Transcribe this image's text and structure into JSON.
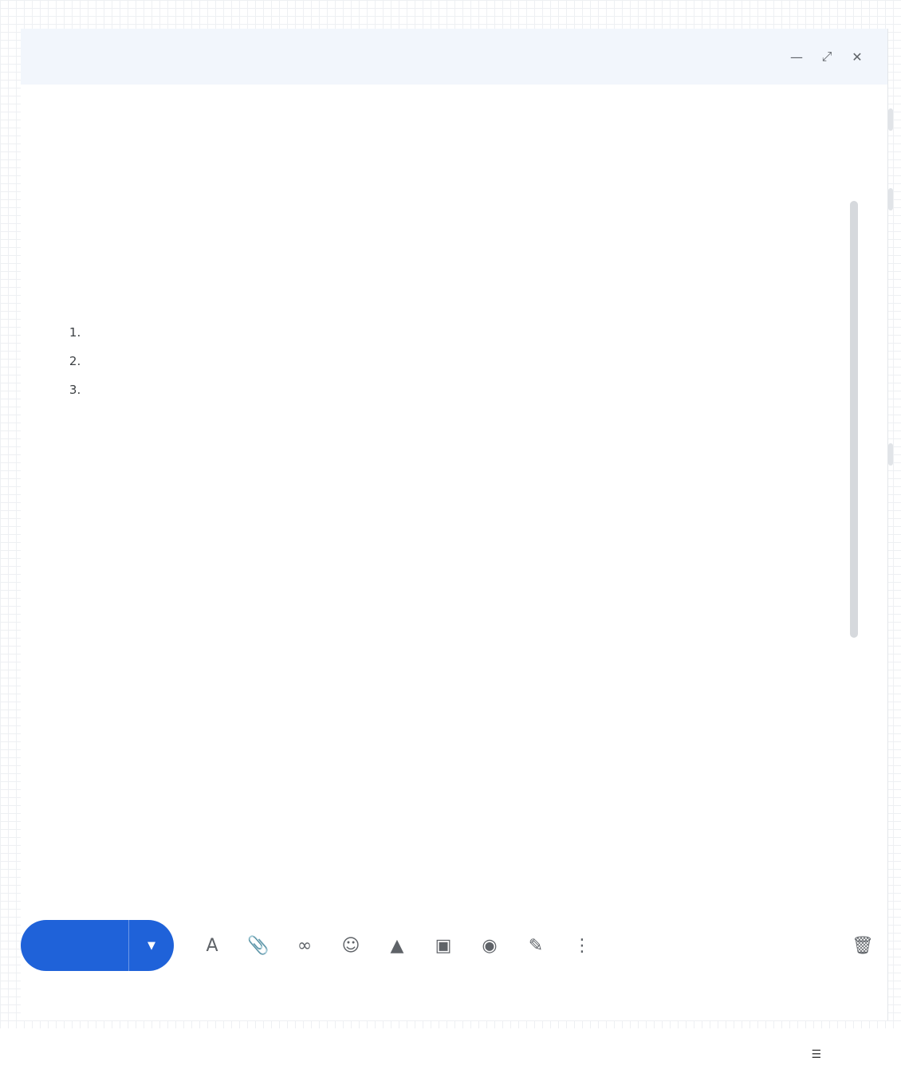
{
  "header": {
    "title": "",
    "minimize_icon": "minimize-icon",
    "expand_icon": "expand-icon",
    "close_icon": "close-icon"
  },
  "to": {
    "recipient": "",
    "cc_bcc": ""
  },
  "subject": "",
  "body": {
    "paragraphs": [
      "",
      "",
      "",
      "",
      "",
      "",
      ""
    ],
    "intro_to_list": "",
    "list": [
      "",
      "",
      ""
    ]
  },
  "toolbar": {
    "send_label": "",
    "icons": [
      "format-text-icon",
      "attach-icon",
      "link-icon",
      "emoji-icon",
      "drive-icon",
      "photo-icon",
      "lock-icon",
      "signature-icon",
      "more-options-icon",
      "delete-icon"
    ]
  },
  "footer": {
    "logo_top": "",
    "logo_bottom": "",
    "nav": [
      "",
      "",
      "",
      "",
      "",
      ""
    ],
    "menu_icon": "menu-icon"
  },
  "colors": {
    "header_bg": "#f2f6fc",
    "header_title": "#3c5fa8",
    "send_button": "#1f62d9"
  }
}
